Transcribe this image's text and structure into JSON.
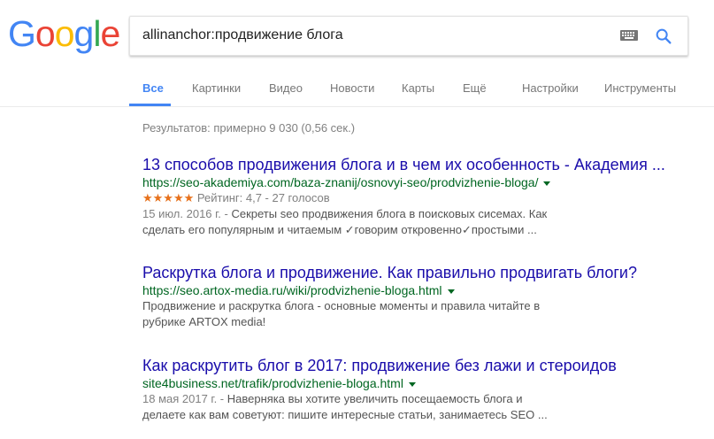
{
  "logo": {
    "letters": [
      "G",
      "o",
      "o",
      "g",
      "l",
      "e"
    ],
    "colors": [
      "#4285f4",
      "#ea4335",
      "#fbbc05",
      "#4285f4",
      "#34a853",
      "#ea4335"
    ]
  },
  "search": {
    "query": "allinanchor:продвижение блога"
  },
  "tabs": [
    {
      "label": "Все"
    },
    {
      "label": "Картинки"
    },
    {
      "label": "Видео"
    },
    {
      "label": "Новости"
    },
    {
      "label": "Карты"
    },
    {
      "label": "Ещё"
    },
    {
      "label": "Настройки"
    },
    {
      "label": "Инструменты"
    }
  ],
  "stats": "Результатов: примерно 9 030 (0,56 сек.)",
  "results": [
    {
      "title": "13 способов продвижения блога и в чем их особенность - Академия ...",
      "url": "https://seo-akademiya.com/baza-znanij/osnovyi-seo/prodvizhenie-bloga/",
      "stars": "★★★★★",
      "rating": "Рейтинг: 4,7 - 27 голосов",
      "date": "15 июл. 2016 г. - ",
      "snippet": "Секреты seo продвижения блога в поисковых сисемах. Как сделать его популярным и читаемым ✓говорим откровенно✓простыми ..."
    },
    {
      "title": "Раскрутка блога и продвижение. Как правильно продвигать блоги?",
      "url": "https://seo.artox-media.ru/wiki/prodvizhenie-bloga.html",
      "date": "",
      "snippet": "Продвижение и раскрутка блога - основные моменты и правила читайте в рубрике ARTOX media!"
    },
    {
      "title": "Как раскрутить блог в 2017: продвижение без лажи и стероидов",
      "url": "site4business.net/trafik/prodvizhenie-bloga.html",
      "date": "18 мая 2017 г. - ",
      "snippet": "Наверняка вы хотите увеличить посещаемость блога и делаете как вам советуют: пишите интересные статьи, занимаетесь SEO ..."
    }
  ]
}
